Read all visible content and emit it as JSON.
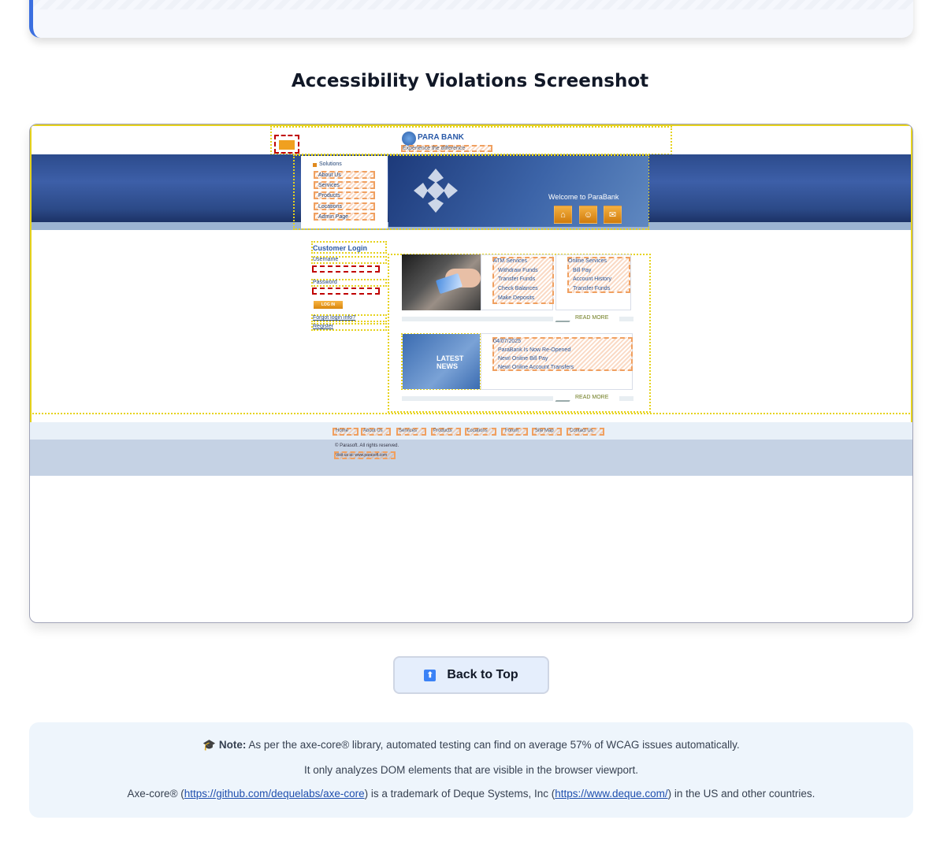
{
  "section_title": "Accessibility Violations Screenshot",
  "parabank": {
    "logo_text": "PARA BANK",
    "tagline": "Experience the difference",
    "solutions_label": "Solutions",
    "menu": [
      "About Us",
      "Services",
      "Products",
      "Locations",
      "Admin Page"
    ],
    "welcome": "Welcome to ParaBank",
    "login": {
      "title": "Customer Login",
      "username_label": "Username",
      "password_label": "Password",
      "button": "LOG IN",
      "forgot": "Forgot login info?",
      "register": "Register"
    },
    "atm_services": {
      "title": "ATM Services",
      "items": [
        "Withdraw Funds",
        "Transfer Funds",
        "Check Balances",
        "Make Deposits"
      ]
    },
    "online_services": {
      "title": "Online Services",
      "items": [
        "Bill Pay",
        "Account History",
        "Transfer Funds"
      ]
    },
    "read_more": "READ MORE",
    "latest_news": {
      "badge_line1": "LATEST",
      "badge_line2": "NEWS",
      "date": "04/07/2025",
      "items": [
        "ParaBank Is Now Re-Opened",
        "New! Online Bill Pay",
        "New! Online Account Transfers"
      ]
    },
    "footer_links": [
      "Home",
      "About Us",
      "Services",
      "Products",
      "Locations",
      "Forum",
      "Site Map",
      "Contact Us"
    ],
    "copyright": "© Parasoft. All rights reserved.",
    "visit_prefix": "Visit us at:",
    "visit_link": "www.parasoft.com"
  },
  "back_to_top": "Back to Top",
  "note": {
    "label": "Note:",
    "line1": "As per the axe-core® library, automated testing can find on average 57% of WCAG issues automatically.",
    "line2": "It only analyzes DOM elements that are visible in the browser viewport.",
    "line3_a": "Axe-core® (",
    "line3_link1": "https://github.com/dequelabs/axe-core",
    "line3_b": ") is a trademark of Deque Systems, Inc (",
    "line3_link2": "https://www.deque.com/",
    "line3_c": ") in the US and other countries."
  },
  "colors": {
    "violation_yellow": "#e6d21c",
    "violation_orange": "#f0a060",
    "violation_red": "#c00000",
    "accent": "#3b82f6"
  }
}
